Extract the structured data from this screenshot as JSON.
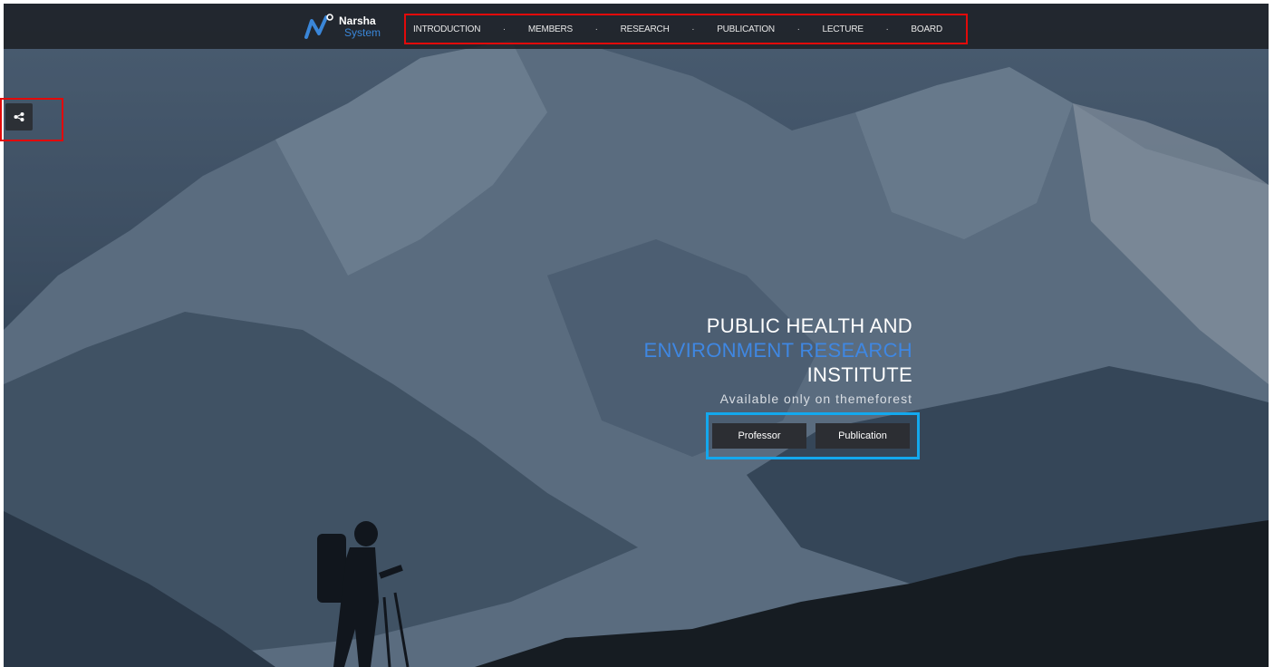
{
  "brand": {
    "name_line1": "Narsha",
    "name_line2": "System"
  },
  "nav": {
    "items": [
      "INTRODUCTION",
      "MEMBERS",
      "RESEARCH",
      "PUBLICATION",
      "LECTURE",
      "BOARD"
    ],
    "separator": "·"
  },
  "sidebar": {
    "share_icon": "share-icon"
  },
  "hero": {
    "line1": "PUBLIC HEALTH AND",
    "line2": "ENVIRONMENT RESEARCH",
    "line3": "INSTITUTE",
    "subtitle": "Available only on themeforest",
    "buttons": {
      "professor": "Professor",
      "publication": "Publication"
    }
  },
  "colors": {
    "accent_blue": "#3f87e2",
    "highlight_red": "#e20a0a",
    "highlight_cyan": "#13a8ee",
    "nav_bg": "#1c2026"
  }
}
